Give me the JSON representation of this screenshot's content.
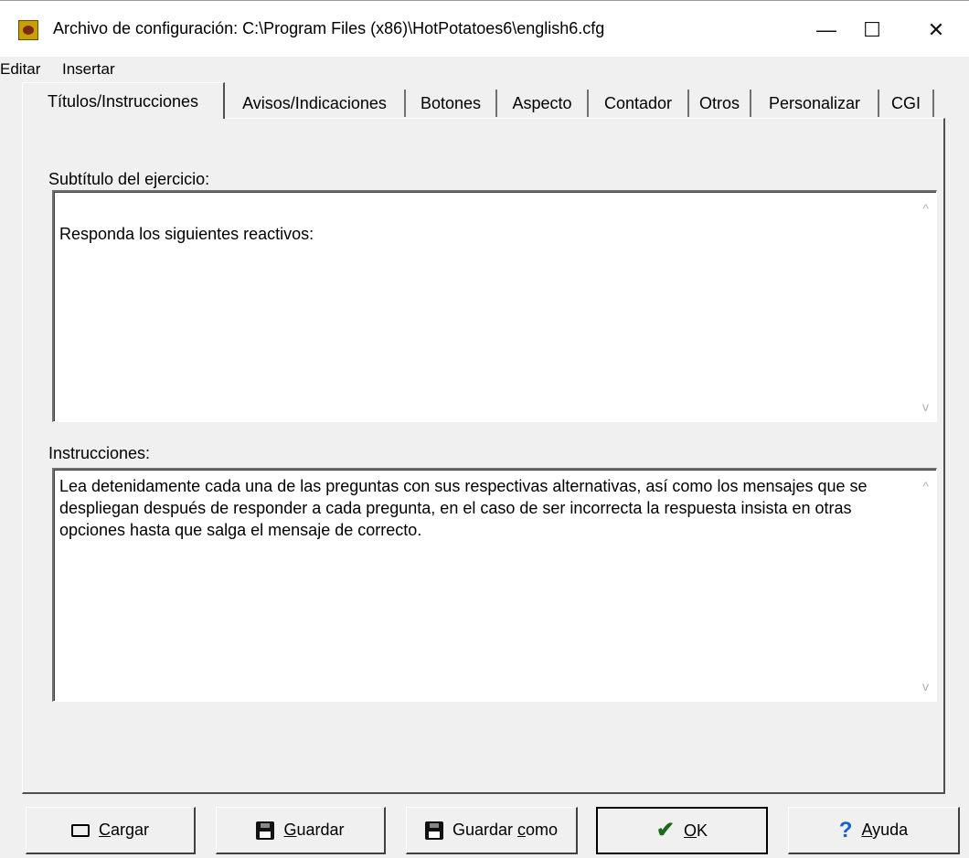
{
  "window": {
    "title": "Archivo de configuración: C:\\Program Files (x86)\\HotPotatoes6\\english6.cfg",
    "icon": "hotpotatoes-icon",
    "minimize_glyph": "—",
    "maximize_glyph": "☐",
    "close_glyph": "✕"
  },
  "menu": {
    "items": [
      "Editar",
      "Insertar"
    ]
  },
  "tabs": [
    {
      "label": "Títulos/Instrucciones",
      "active": true
    },
    {
      "label": "Avisos/Indicaciones"
    },
    {
      "label": "Botones"
    },
    {
      "label": "Aspecto"
    },
    {
      "label": "Contador"
    },
    {
      "label": "Otros"
    },
    {
      "label": "Personalizar"
    },
    {
      "label": "CGI"
    }
  ],
  "subtitle_field": {
    "label": "Subtítulo del ejercicio:",
    "value": "Responda los siguientes reactivos:"
  },
  "instructions_field": {
    "label": "Instrucciones:",
    "value": "Lea detenidamente cada una de las preguntas con sus respectivas alternativas, así como los mensajes que se despliegan después de responder a cada pregunta, en el caso de ser incorrecta la respuesta insista en otras opciones hasta que salga el mensaje de correcto."
  },
  "scroll": {
    "up": "^",
    "down": "v"
  },
  "buttons": {
    "load": {
      "underline": "C",
      "rest": "argar",
      "icon": "folder-icon"
    },
    "save": {
      "underline": "G",
      "rest": "uardar",
      "icon": "floppy-icon"
    },
    "save_as": {
      "prefix": "Guardar ",
      "underline": "c",
      "rest": "omo",
      "icon": "save-as-icon"
    },
    "ok": {
      "underline": "O",
      "rest": "K",
      "icon": "check-icon"
    },
    "help": {
      "underline": "A",
      "rest": "yuda",
      "icon": "help-icon"
    }
  },
  "colors": {
    "face": "#f0f0f0",
    "check": "#1a6a1a",
    "help": "#1a5fd0"
  }
}
